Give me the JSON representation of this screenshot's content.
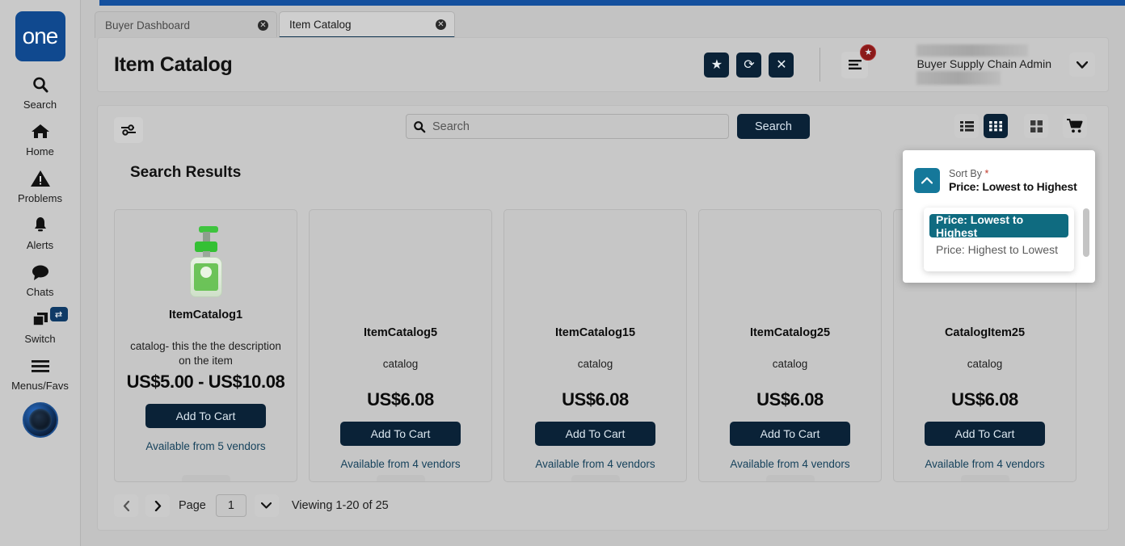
{
  "sidebar": {
    "logo_text": "one",
    "items": [
      {
        "label": "Search",
        "icon": "search-icon"
      },
      {
        "label": "Home",
        "icon": "home-icon"
      },
      {
        "label": "Problems",
        "icon": "warning-triangle-icon"
      },
      {
        "label": "Alerts",
        "icon": "bell-icon"
      },
      {
        "label": "Chats",
        "icon": "chat-bubble-icon"
      },
      {
        "label": "Switch",
        "icon": "windows-stack-icon"
      },
      {
        "label": "Menus/Favs",
        "icon": "hamburger-icon"
      }
    ],
    "switch_badge": "⇄",
    "avatar": "user-avatar"
  },
  "tabs": [
    {
      "label": "Buyer Dashboard",
      "active": false,
      "close": "✕"
    },
    {
      "label": "Item Catalog",
      "active": true,
      "close": "✕"
    }
  ],
  "header": {
    "title": "Item Catalog",
    "actions": [
      {
        "name": "favorite-button",
        "glyph": "★"
      },
      {
        "name": "refresh-button",
        "glyph": "⟳"
      },
      {
        "name": "close-button",
        "glyph": "✕"
      }
    ],
    "menu_button": "menu-icon",
    "favorites_badge": "★",
    "user_name": "Buyer Supply Chain Admin",
    "user_caret": "⌄"
  },
  "toolbar": {
    "filter_button": "filter-sliders-icon",
    "search": {
      "placeholder": "Search",
      "value": ""
    },
    "search_button_label": "Search",
    "views": [
      {
        "name": "list-view-toggle",
        "selected": false
      },
      {
        "name": "grid-view-toggle",
        "selected": true
      },
      {
        "name": "tile-view-toggle",
        "selected": false
      }
    ],
    "cart_button": "shopping-cart-icon"
  },
  "results": {
    "title": "Search Results",
    "cards": [
      {
        "name": "ItemCatalog1",
        "description": "catalog- this the the description on the item",
        "price": "US$5.00 - US$10.08",
        "add_label": "Add To Cart",
        "vendors": "Available from 5 vendors",
        "has_image": true
      },
      {
        "name": "ItemCatalog5",
        "description": "catalog",
        "price": "US$6.08",
        "add_label": "Add To Cart",
        "vendors": "Available from 4 vendors",
        "has_image": false
      },
      {
        "name": "ItemCatalog15",
        "description": "catalog",
        "price": "US$6.08",
        "add_label": "Add To Cart",
        "vendors": "Available from 4 vendors",
        "has_image": false
      },
      {
        "name": "ItemCatalog25",
        "description": "catalog",
        "price": "US$6.08",
        "add_label": "Add To Cart",
        "vendors": "Available from 4 vendors",
        "has_image": false
      },
      {
        "name": "CatalogItem25",
        "description": "catalog",
        "price": "US$6.08",
        "add_label": "Add To Cart",
        "vendors": "Available from 4 vendors",
        "has_image": false
      }
    ]
  },
  "pagination": {
    "prev": "‹",
    "next": "›",
    "page_label": "Page",
    "page_value": "1",
    "caret": "⌄",
    "viewing": "Viewing 1-20 of 25"
  },
  "sort_panel": {
    "toggle_icon": "chevron-up-icon",
    "label": "Sort By",
    "required_marker": "*",
    "value": "Price: Lowest to Highest",
    "options": [
      {
        "label": "Price: Lowest to Highest",
        "selected": true
      },
      {
        "label": "Price: Highest to Lowest",
        "selected": false
      }
    ]
  },
  "colors": {
    "brand_blue": "#14509e",
    "navy": "#0a2237",
    "teal": "#15789a",
    "teal_dark": "#0f6b80",
    "badge_red": "#8b1a1a",
    "link": "#16425c",
    "page_bg": "#c3c3c3"
  }
}
